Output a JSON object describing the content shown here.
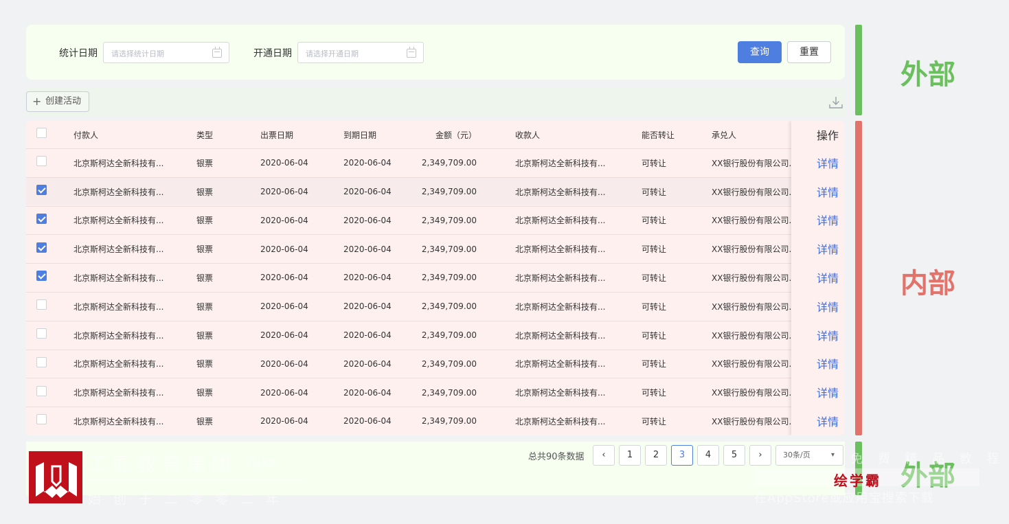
{
  "search": {
    "stat_date_label": "统计日期",
    "stat_date_placeholder": "请选择统计日期",
    "open_date_label": "开通日期",
    "open_date_placeholder": "请选择开通日期",
    "query_label": "查询",
    "reset_label": "重置"
  },
  "toolbar": {
    "create_label": "创建活动",
    "create_icon": "plus-icon",
    "download_icon": "download-icon"
  },
  "table": {
    "headers": [
      "付款人",
      "类型",
      "出票日期",
      "到期日期",
      "金额（元）",
      "收款人",
      "能否转让",
      "承兑人",
      "操作"
    ],
    "rows": [
      {
        "checked": false,
        "payer": "北京斯柯达全新科技有...",
        "type": "银票",
        "issue": "2020-06-04",
        "due": "2020-06-04",
        "amount": "2,349,709.00",
        "payee": "北京斯柯达全新科技有...",
        "transfer": "可转让",
        "acceptor": "XX银行股份有限公司...",
        "action": "详情"
      },
      {
        "checked": true,
        "payer": "北京斯柯达全新科技有...",
        "type": "银票",
        "issue": "2020-06-04",
        "due": "2020-06-04",
        "amount": "2,349,709.00",
        "payee": "北京斯柯达全新科技有...",
        "transfer": "可转让",
        "acceptor": "XX银行股份有限公司...",
        "action": "详情"
      },
      {
        "checked": true,
        "payer": "北京斯柯达全新科技有...",
        "type": "银票",
        "issue": "2020-06-04",
        "due": "2020-06-04",
        "amount": "2,349,709.00",
        "payee": "北京斯柯达全新科技有...",
        "transfer": "可转让",
        "acceptor": "XX银行股份有限公司...",
        "action": "详情"
      },
      {
        "checked": true,
        "payer": "北京斯柯达全新科技有...",
        "type": "银票",
        "issue": "2020-06-04",
        "due": "2020-06-04",
        "amount": "2,349,709.00",
        "payee": "北京斯柯达全新科技有...",
        "transfer": "可转让",
        "acceptor": "XX银行股份有限公司...",
        "action": "详情"
      },
      {
        "checked": true,
        "payer": "北京斯柯达全新科技有...",
        "type": "银票",
        "issue": "2020-06-04",
        "due": "2020-06-04",
        "amount": "2,349,709.00",
        "payee": "北京斯柯达全新科技有...",
        "transfer": "可转让",
        "acceptor": "XX银行股份有限公司...",
        "action": "详情"
      },
      {
        "checked": false,
        "payer": "北京斯柯达全新科技有...",
        "type": "银票",
        "issue": "2020-06-04",
        "due": "2020-06-04",
        "amount": "2,349,709.00",
        "payee": "北京斯柯达全新科技有...",
        "transfer": "可转让",
        "acceptor": "XX银行股份有限公司...",
        "action": "详情"
      },
      {
        "checked": false,
        "payer": "北京斯柯达全新科技有...",
        "type": "银票",
        "issue": "2020-06-04",
        "due": "2020-06-04",
        "amount": "2,349,709.00",
        "payee": "北京斯柯达全新科技有...",
        "transfer": "可转让",
        "acceptor": "XX银行股份有限公司...",
        "action": "详情"
      },
      {
        "checked": false,
        "payer": "北京斯柯达全新科技有...",
        "type": "银票",
        "issue": "2020-06-04",
        "due": "2020-06-04",
        "amount": "2,349,709.00",
        "payee": "北京斯柯达全新科技有...",
        "transfer": "可转让",
        "acceptor": "XX银行股份有限公司...",
        "action": "详情"
      },
      {
        "checked": false,
        "payer": "北京斯柯达全新科技有...",
        "type": "银票",
        "issue": "2020-06-04",
        "due": "2020-06-04",
        "amount": "2,349,709.00",
        "payee": "北京斯柯达全新科技有...",
        "transfer": "可转让",
        "acceptor": "XX银行股份有限公司...",
        "action": "详情"
      },
      {
        "checked": false,
        "payer": "北京斯柯达全新科技有...",
        "type": "银票",
        "issue": "2020-06-04",
        "due": "2020-06-04",
        "amount": "2,349,709.00",
        "payee": "北京斯柯达全新科技有...",
        "transfer": "可转让",
        "acceptor": "XX银行股份有限公司...",
        "action": "详情"
      }
    ]
  },
  "pagination": {
    "total_text": "总共90条数据",
    "pages": [
      "1",
      "2",
      "3",
      "4",
      "5"
    ],
    "current": "3",
    "page_size": "30条/页"
  },
  "annotations": {
    "outer_top": "外部",
    "inner": "内部",
    "outer_bottom": "外部",
    "outer_color": "#6cbf5e",
    "inner_color": "#e2736a"
  },
  "watermark": {
    "company": "工匠教育集团",
    "company_sub": "GJXX",
    "since": "始 创 于 二 零 零 二 年",
    "free_tutorial": "免 费 精 品 教 程",
    "brand": "绘学霸",
    "download_hint": "在AppStore或应用宝搜索下载"
  },
  "colors": {
    "primary": "#4e7ee0",
    "search_bg": "#f6fff0",
    "table_bg": "#fdf0ef",
    "logo_red": "#c0101c"
  }
}
